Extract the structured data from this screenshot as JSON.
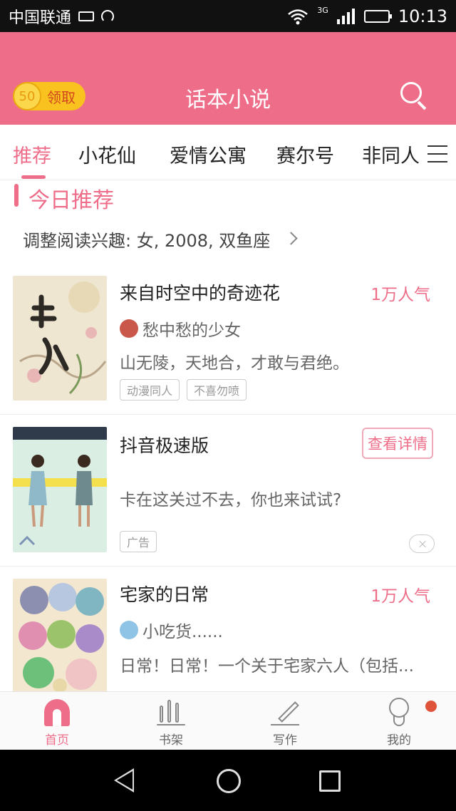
{
  "status_bar": {
    "carrier": "中国联通",
    "network": "3G",
    "time": "10:13",
    "battery_level": 0.9
  },
  "header": {
    "coin_count": "50",
    "claim_label": "领取",
    "title": "话本小说"
  },
  "tabs": [
    {
      "label": "推荐",
      "active": true
    },
    {
      "label": "小花仙",
      "active": false
    },
    {
      "label": "爱情公寓",
      "active": false
    },
    {
      "label": "赛尔号",
      "active": false
    },
    {
      "label": "非同人",
      "active": false
    }
  ],
  "section": {
    "title": "今日推荐",
    "interest_text": "调整阅读兴趣: 女, 2008, 双鱼座"
  },
  "books": [
    {
      "title": "来自时空中的奇迹花",
      "popularity": "1万人气",
      "author": "愁中愁的少女",
      "description": "山无陵，天地合，才敢与君绝。",
      "tags": [
        "动漫同人",
        "不喜勿喷"
      ]
    },
    {
      "title": "宅家的日常",
      "popularity": "1万人气",
      "author": "小吃货......",
      "description": "日常！日常！一个关于宅家六人（包括..."
    }
  ],
  "ad": {
    "title": "抖音极速版",
    "button_label": "查看详情",
    "description": "卡在这关过不去，你也来试试?",
    "tag": "广告"
  },
  "bottom_nav": [
    {
      "label": "首页",
      "active": true
    },
    {
      "label": "书架",
      "active": false
    },
    {
      "label": "写作",
      "active": false
    },
    {
      "label": "我的",
      "active": false
    }
  ],
  "colors": {
    "accent": "#ee6e8a",
    "coin": "#f9c21e",
    "badge": "#e0533b"
  }
}
